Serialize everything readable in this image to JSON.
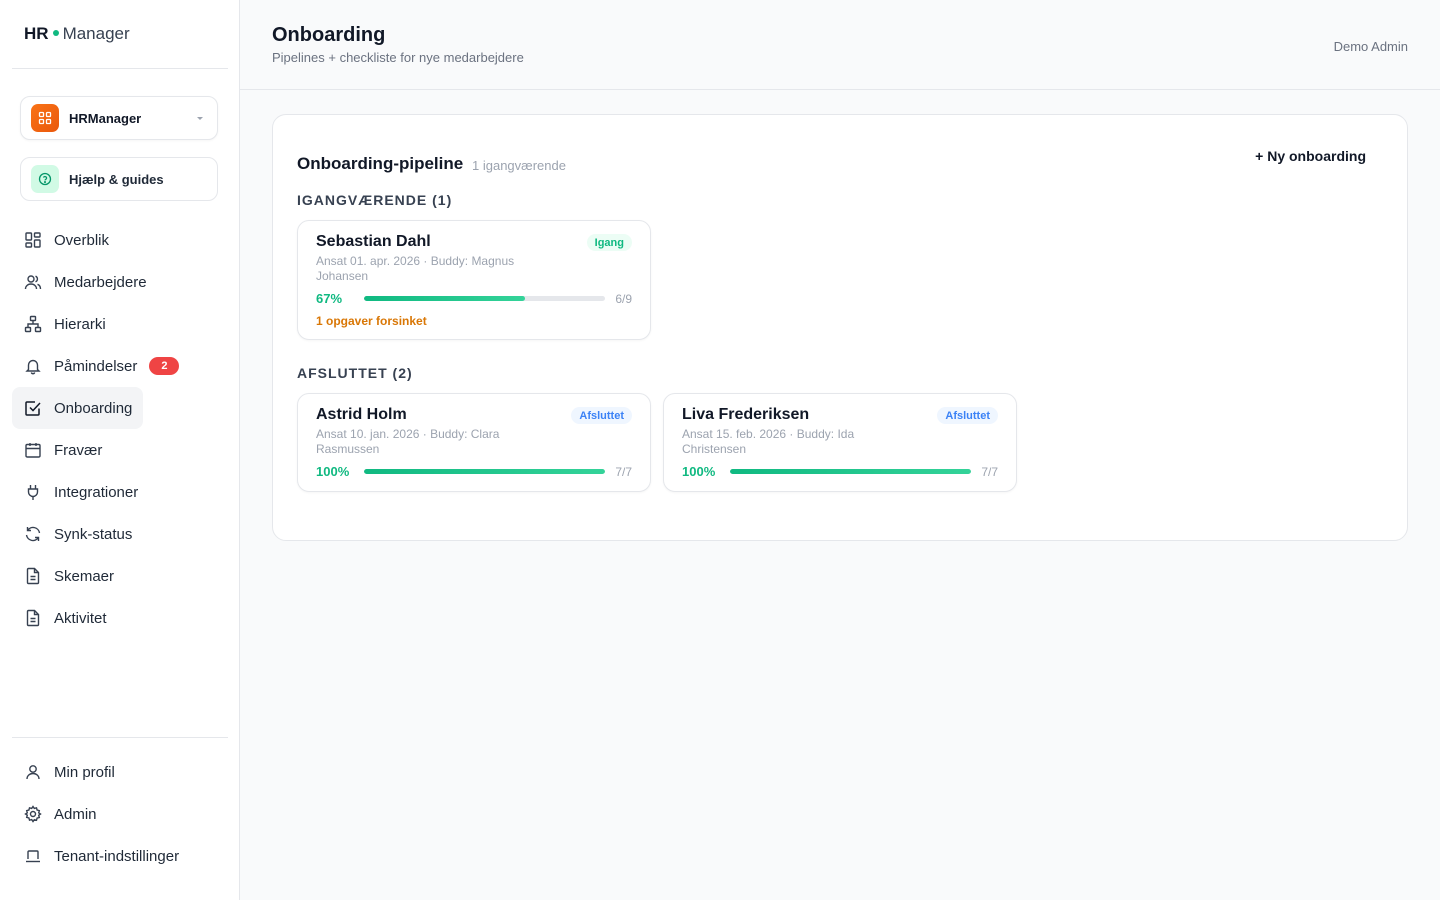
{
  "app": {
    "logo_hr": "HR",
    "logo_manager": "Manager"
  },
  "tenant": {
    "name": "HRManager"
  },
  "help": {
    "label": "Hjælp & guides"
  },
  "nav": [
    {
      "label": "Overblik",
      "icon": "grid-icon"
    },
    {
      "label": "Medarbejdere",
      "icon": "users-icon"
    },
    {
      "label": "Hierarki",
      "icon": "hierarchy-icon"
    },
    {
      "label": "Påmindelser",
      "icon": "bell-icon",
      "badge": "2"
    },
    {
      "label": "Onboarding",
      "icon": "checkbox-icon",
      "active": true
    },
    {
      "label": "Fravær",
      "icon": "calendar-icon"
    },
    {
      "label": "Integrationer",
      "icon": "plug-icon"
    },
    {
      "label": "Synk-status",
      "icon": "refresh-icon"
    },
    {
      "label": "Skemaer",
      "icon": "document-icon"
    },
    {
      "label": "Aktivitet",
      "icon": "document-icon"
    }
  ],
  "nav_bottom": [
    {
      "label": "Min profil",
      "icon": "user-icon"
    },
    {
      "label": "Admin",
      "icon": "gear-icon"
    },
    {
      "label": "Tenant-indstillinger",
      "icon": "laptop-icon"
    }
  ],
  "header": {
    "title": "Onboarding",
    "subtitle": "Pipelines + checkliste for nye medarbejdere",
    "user": "Demo Admin"
  },
  "pipeline": {
    "title": "Onboarding-pipeline",
    "count_label": "1 igangværende",
    "new_button": "+ Ny onboarding",
    "ongoing_title": "IGANGVÆRENDE (1)",
    "done_title": "AFSLUTTET (2)",
    "ongoing": [
      {
        "name": "Sebastian Dahl",
        "meta": "Ansat 01. apr. 2026 · Buddy: Magnus Johansen",
        "status": "Igang",
        "percent_label": "67%",
        "progress": 0.67,
        "fraction": "6/9",
        "late": "1 opgaver forsinket"
      }
    ],
    "done": [
      {
        "name": "Astrid Holm",
        "meta": "Ansat 10. jan. 2026 · Buddy: Clara Rasmussen",
        "status": "Afsluttet",
        "percent_label": "100%",
        "progress": 1.0,
        "fraction": "7/7"
      },
      {
        "name": "Liva Frederiksen",
        "meta": "Ansat 15. feb. 2026 · Buddy: Ida Christensen",
        "status": "Afsluttet",
        "percent_label": "100%",
        "progress": 1.0,
        "fraction": "7/7"
      }
    ]
  },
  "colors": {
    "accent": "#10b981",
    "badge": "#ef4444",
    "late": "#d97706",
    "done_badge": "#3b82f6"
  }
}
